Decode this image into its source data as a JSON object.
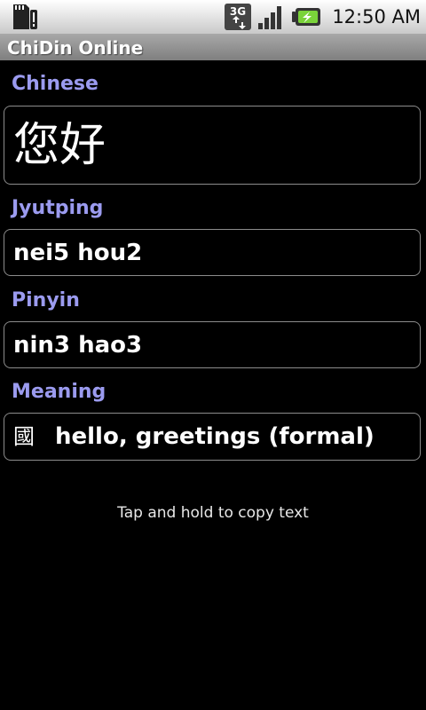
{
  "status_bar": {
    "time": "12:50 AM",
    "network_label": "3G",
    "icons": {
      "sd_card": "sd-card-alert-icon",
      "network": "3g-data-icon",
      "signal": "signal-strength-icon",
      "battery": "battery-charging-icon"
    }
  },
  "app": {
    "title": "ChiDin Online"
  },
  "sections": {
    "chinese": {
      "label": "Chinese",
      "value": "您好"
    },
    "jyutping": {
      "label": "Jyutping",
      "value": "nei5 hou2"
    },
    "pinyin": {
      "label": "Pinyin",
      "value": "nin3 hao3"
    },
    "meaning": {
      "label": "Meaning",
      "icon_glyph": "國",
      "value": "hello, greetings (formal)"
    }
  },
  "hint": "Tap and hold to copy text",
  "colors": {
    "label": "#9b9bef",
    "background": "#000000",
    "border": "#8c8c8c"
  }
}
